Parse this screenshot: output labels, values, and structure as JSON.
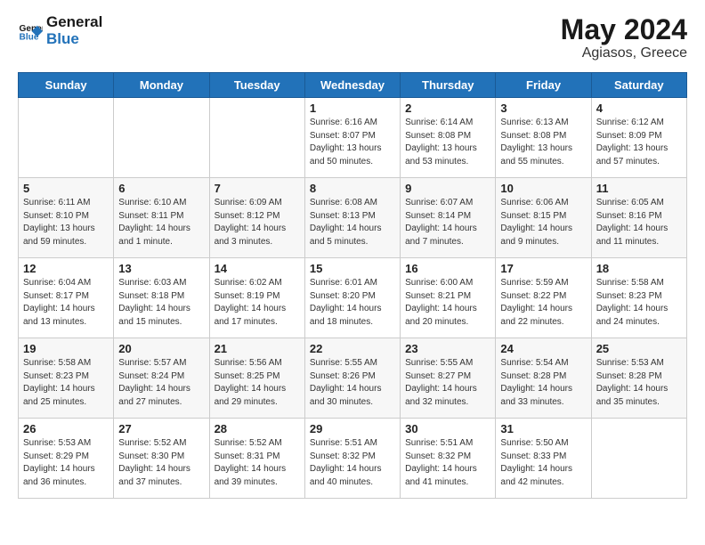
{
  "header": {
    "logo_text_general": "General",
    "logo_text_blue": "Blue",
    "month": "May 2024",
    "location": "Agiasos, Greece"
  },
  "days_of_week": [
    "Sunday",
    "Monday",
    "Tuesday",
    "Wednesday",
    "Thursday",
    "Friday",
    "Saturday"
  ],
  "weeks": [
    [
      {
        "day": "",
        "info": ""
      },
      {
        "day": "",
        "info": ""
      },
      {
        "day": "",
        "info": ""
      },
      {
        "day": "1",
        "info": "Sunrise: 6:16 AM\nSunset: 8:07 PM\nDaylight: 13 hours\nand 50 minutes."
      },
      {
        "day": "2",
        "info": "Sunrise: 6:14 AM\nSunset: 8:08 PM\nDaylight: 13 hours\nand 53 minutes."
      },
      {
        "day": "3",
        "info": "Sunrise: 6:13 AM\nSunset: 8:08 PM\nDaylight: 13 hours\nand 55 minutes."
      },
      {
        "day": "4",
        "info": "Sunrise: 6:12 AM\nSunset: 8:09 PM\nDaylight: 13 hours\nand 57 minutes."
      }
    ],
    [
      {
        "day": "5",
        "info": "Sunrise: 6:11 AM\nSunset: 8:10 PM\nDaylight: 13 hours\nand 59 minutes."
      },
      {
        "day": "6",
        "info": "Sunrise: 6:10 AM\nSunset: 8:11 PM\nDaylight: 14 hours\nand 1 minute."
      },
      {
        "day": "7",
        "info": "Sunrise: 6:09 AM\nSunset: 8:12 PM\nDaylight: 14 hours\nand 3 minutes."
      },
      {
        "day": "8",
        "info": "Sunrise: 6:08 AM\nSunset: 8:13 PM\nDaylight: 14 hours\nand 5 minutes."
      },
      {
        "day": "9",
        "info": "Sunrise: 6:07 AM\nSunset: 8:14 PM\nDaylight: 14 hours\nand 7 minutes."
      },
      {
        "day": "10",
        "info": "Sunrise: 6:06 AM\nSunset: 8:15 PM\nDaylight: 14 hours\nand 9 minutes."
      },
      {
        "day": "11",
        "info": "Sunrise: 6:05 AM\nSunset: 8:16 PM\nDaylight: 14 hours\nand 11 minutes."
      }
    ],
    [
      {
        "day": "12",
        "info": "Sunrise: 6:04 AM\nSunset: 8:17 PM\nDaylight: 14 hours\nand 13 minutes."
      },
      {
        "day": "13",
        "info": "Sunrise: 6:03 AM\nSunset: 8:18 PM\nDaylight: 14 hours\nand 15 minutes."
      },
      {
        "day": "14",
        "info": "Sunrise: 6:02 AM\nSunset: 8:19 PM\nDaylight: 14 hours\nand 17 minutes."
      },
      {
        "day": "15",
        "info": "Sunrise: 6:01 AM\nSunset: 8:20 PM\nDaylight: 14 hours\nand 18 minutes."
      },
      {
        "day": "16",
        "info": "Sunrise: 6:00 AM\nSunset: 8:21 PM\nDaylight: 14 hours\nand 20 minutes."
      },
      {
        "day": "17",
        "info": "Sunrise: 5:59 AM\nSunset: 8:22 PM\nDaylight: 14 hours\nand 22 minutes."
      },
      {
        "day": "18",
        "info": "Sunrise: 5:58 AM\nSunset: 8:23 PM\nDaylight: 14 hours\nand 24 minutes."
      }
    ],
    [
      {
        "day": "19",
        "info": "Sunrise: 5:58 AM\nSunset: 8:23 PM\nDaylight: 14 hours\nand 25 minutes."
      },
      {
        "day": "20",
        "info": "Sunrise: 5:57 AM\nSunset: 8:24 PM\nDaylight: 14 hours\nand 27 minutes."
      },
      {
        "day": "21",
        "info": "Sunrise: 5:56 AM\nSunset: 8:25 PM\nDaylight: 14 hours\nand 29 minutes."
      },
      {
        "day": "22",
        "info": "Sunrise: 5:55 AM\nSunset: 8:26 PM\nDaylight: 14 hours\nand 30 minutes."
      },
      {
        "day": "23",
        "info": "Sunrise: 5:55 AM\nSunset: 8:27 PM\nDaylight: 14 hours\nand 32 minutes."
      },
      {
        "day": "24",
        "info": "Sunrise: 5:54 AM\nSunset: 8:28 PM\nDaylight: 14 hours\nand 33 minutes."
      },
      {
        "day": "25",
        "info": "Sunrise: 5:53 AM\nSunset: 8:28 PM\nDaylight: 14 hours\nand 35 minutes."
      }
    ],
    [
      {
        "day": "26",
        "info": "Sunrise: 5:53 AM\nSunset: 8:29 PM\nDaylight: 14 hours\nand 36 minutes."
      },
      {
        "day": "27",
        "info": "Sunrise: 5:52 AM\nSunset: 8:30 PM\nDaylight: 14 hours\nand 37 minutes."
      },
      {
        "day": "28",
        "info": "Sunrise: 5:52 AM\nSunset: 8:31 PM\nDaylight: 14 hours\nand 39 minutes."
      },
      {
        "day": "29",
        "info": "Sunrise: 5:51 AM\nSunset: 8:32 PM\nDaylight: 14 hours\nand 40 minutes."
      },
      {
        "day": "30",
        "info": "Sunrise: 5:51 AM\nSunset: 8:32 PM\nDaylight: 14 hours\nand 41 minutes."
      },
      {
        "day": "31",
        "info": "Sunrise: 5:50 AM\nSunset: 8:33 PM\nDaylight: 14 hours\nand 42 minutes."
      },
      {
        "day": "",
        "info": ""
      }
    ]
  ]
}
